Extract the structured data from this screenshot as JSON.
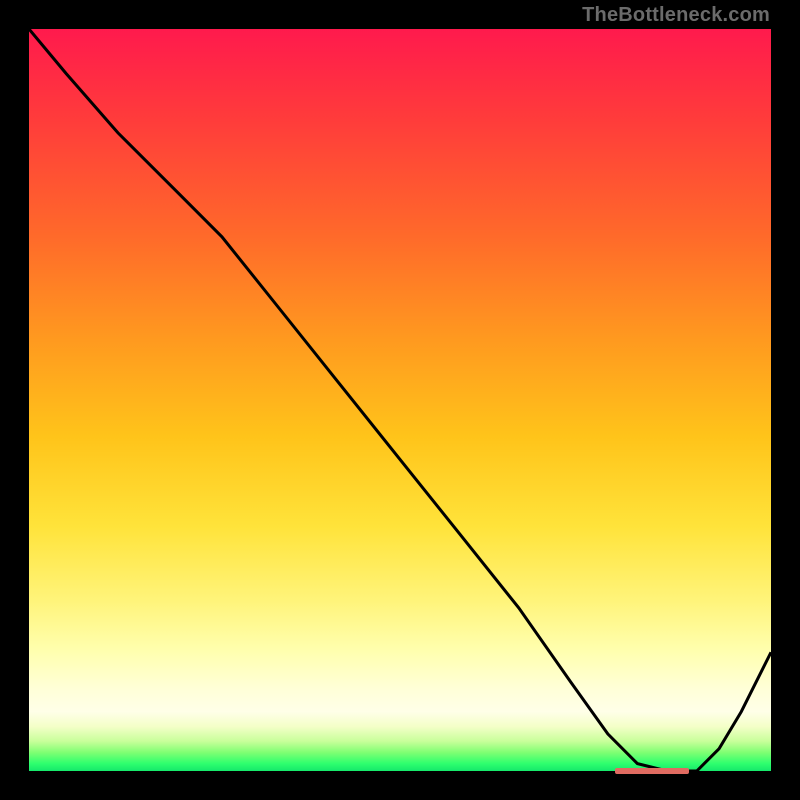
{
  "watermark": "TheBottleneck.com",
  "colors": {
    "gradient_top": "#ff1a4d",
    "gradient_mid": "#ffe33a",
    "gradient_bottom": "#15e86b",
    "curve": "#000000",
    "highlight": "#e06b61",
    "frame": "#000000"
  },
  "chart_data": {
    "type": "line",
    "title": "",
    "xlabel": "",
    "ylabel": "",
    "xlim": [
      0,
      100
    ],
    "ylim": [
      0,
      100
    ],
    "grid": false,
    "legend": false,
    "series": [
      {
        "name": "curve",
        "x": [
          0,
          5,
          12,
          20,
          26,
          34,
          42,
          50,
          58,
          66,
          73,
          78,
          82,
          86,
          90,
          93,
          96,
          100
        ],
        "values": [
          100,
          94,
          86,
          78,
          72,
          62,
          52,
          42,
          32,
          22,
          12,
          5,
          1,
          0,
          0,
          3,
          8,
          16
        ]
      }
    ],
    "highlight_range_x": [
      79,
      89
    ],
    "highlight_y": 0
  }
}
